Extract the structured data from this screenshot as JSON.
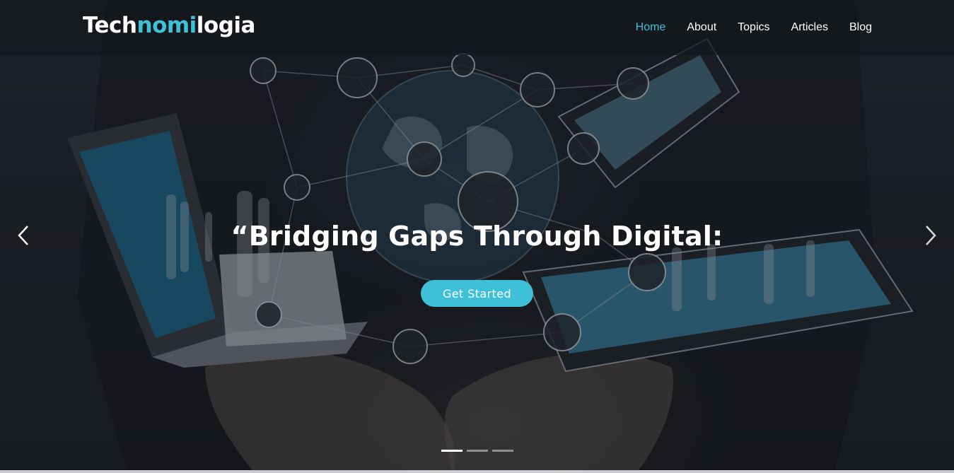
{
  "header": {
    "logo": {
      "part1": "Tech",
      "part2": "nomi",
      "part3": "logia"
    },
    "nav": [
      "Home",
      "About",
      "Topics",
      "Articles",
      "Blog"
    ],
    "active_nav": "Home"
  },
  "hero": {
    "headline": "“Bridging Gaps Through Digital:",
    "cta_label": "Get Started",
    "slide_count": 3,
    "active_slide": 1
  },
  "colors": {
    "accent": "#3fc0d9",
    "topbar": "#14161a",
    "text": "#ffffff"
  },
  "icons": [
    "chevron-left-icon",
    "chevron-right-icon"
  ]
}
